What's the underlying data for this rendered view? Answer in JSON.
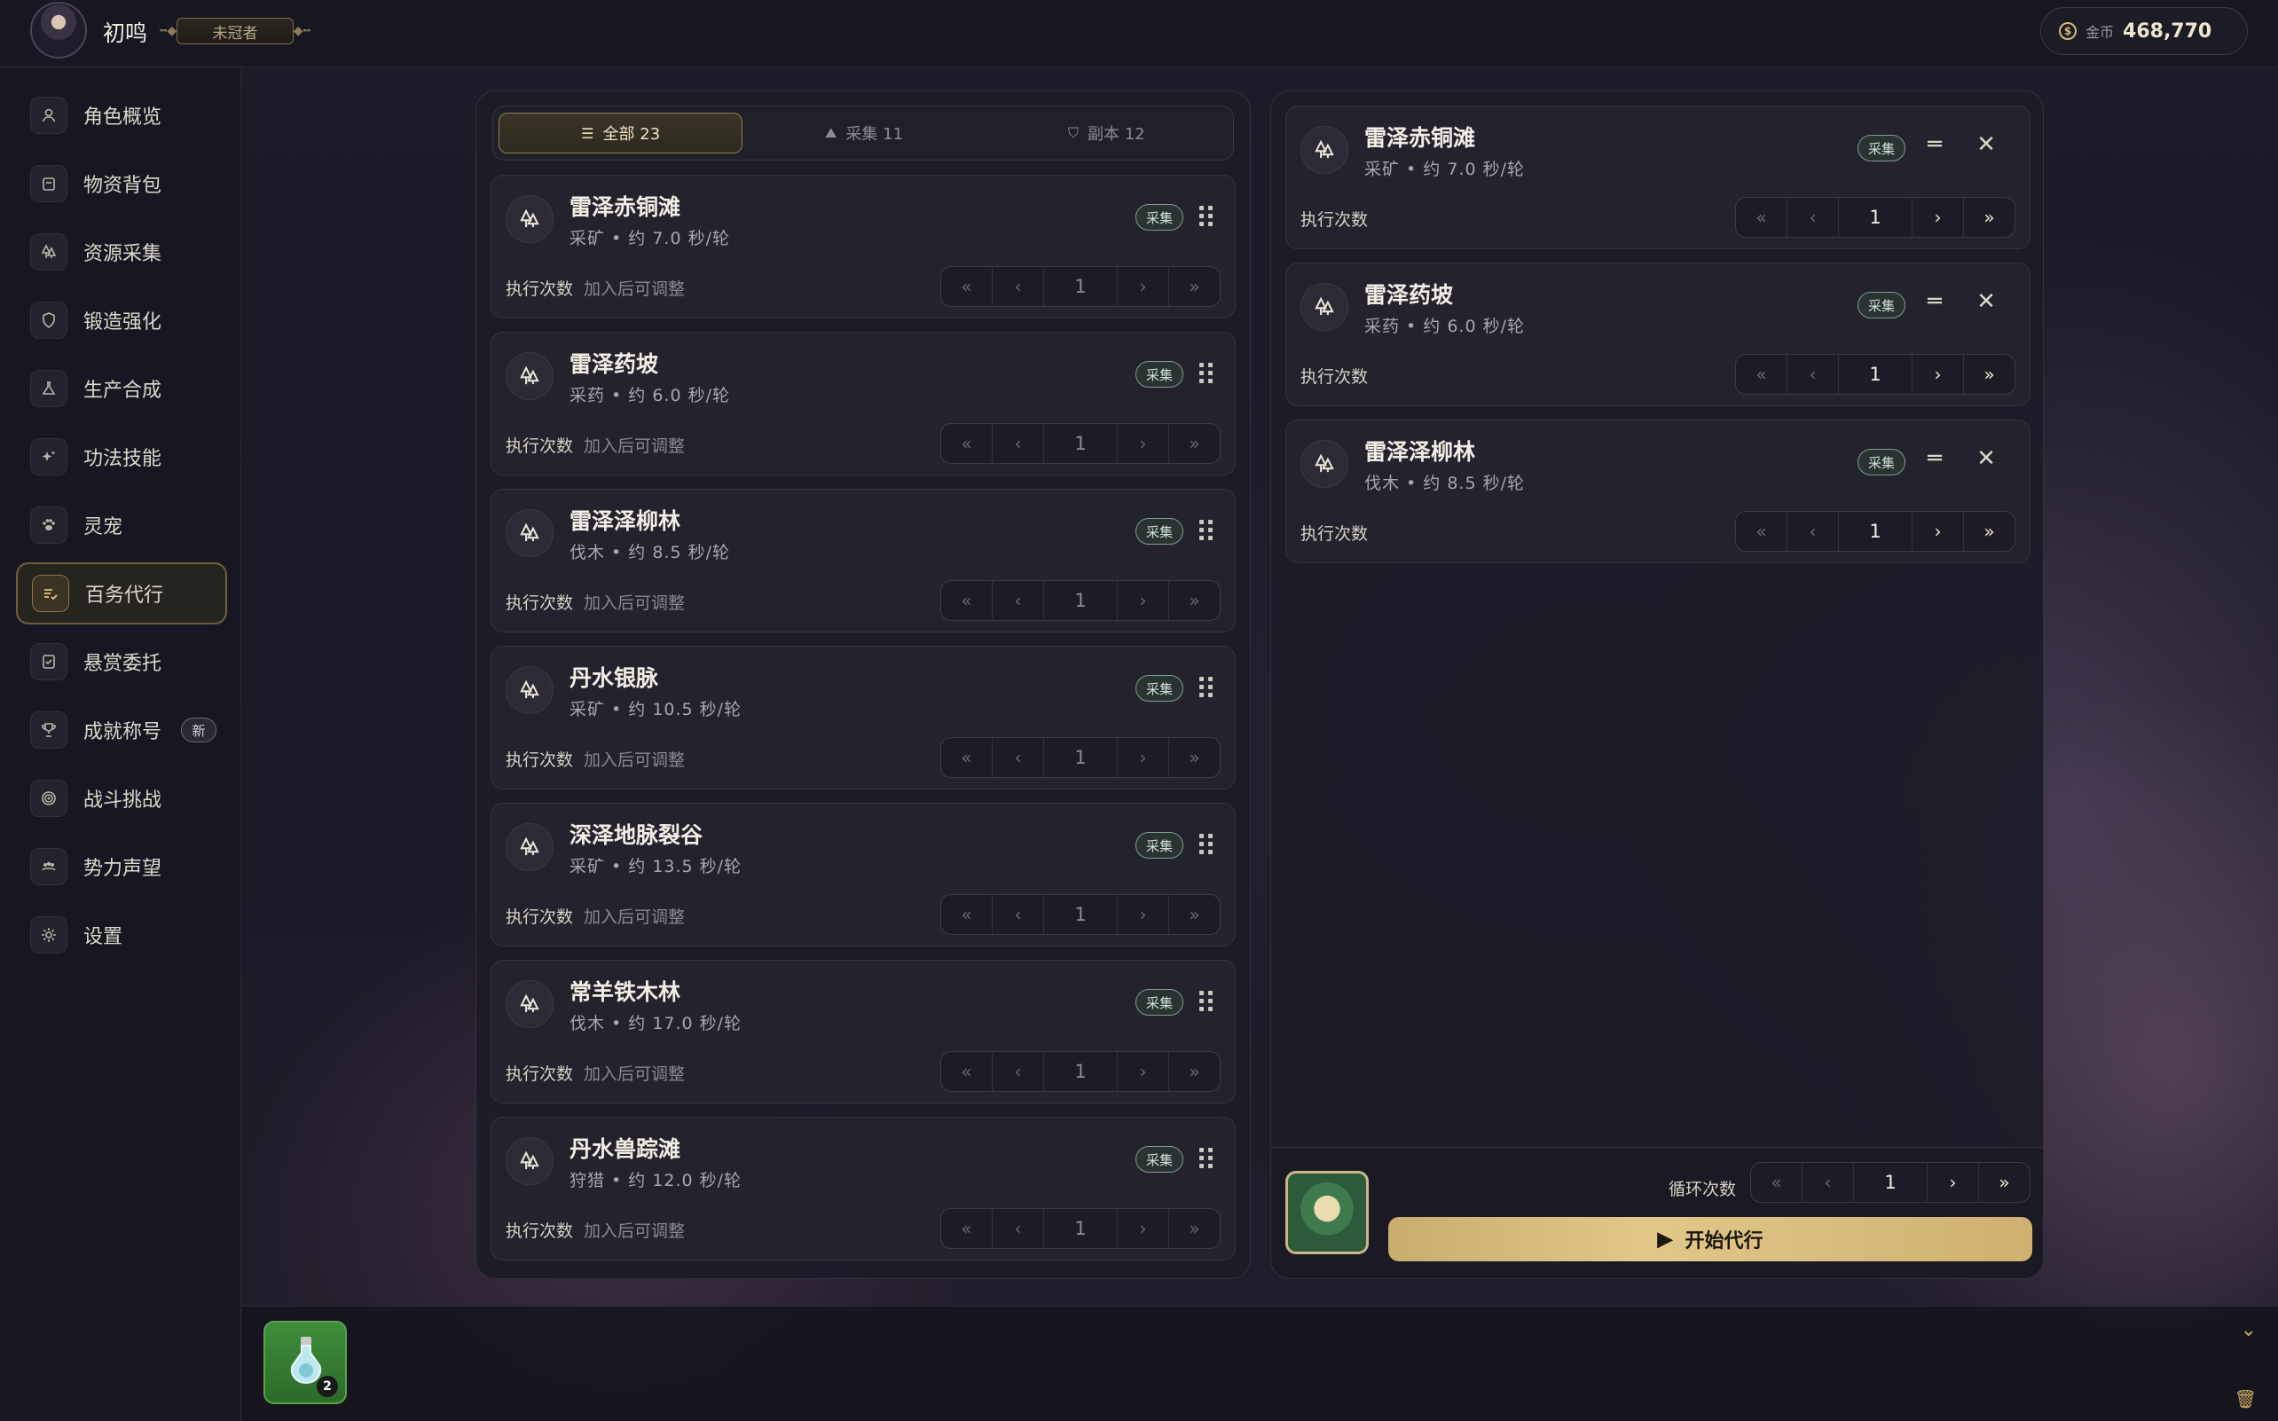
{
  "header": {
    "username": "初鸣",
    "title_badge": "未冠者",
    "gold_label": "金币",
    "gold_value": "468,770"
  },
  "sidebar": {
    "items": [
      {
        "label": "角色概览",
        "icon": "person-icon"
      },
      {
        "label": "物资背包",
        "icon": "backpack-icon"
      },
      {
        "label": "资源采集",
        "icon": "trees-icon"
      },
      {
        "label": "锻造强化",
        "icon": "shield-icon"
      },
      {
        "label": "生产合成",
        "icon": "flask-icon"
      },
      {
        "label": "功法技能",
        "icon": "sparkles-icon"
      },
      {
        "label": "灵宠",
        "icon": "paw-icon"
      },
      {
        "label": "百务代行",
        "icon": "list-check-icon",
        "active": true
      },
      {
        "label": "悬赏委托",
        "icon": "clipboard-check-icon"
      },
      {
        "label": "成就称号",
        "icon": "trophy-icon",
        "badge": "新"
      },
      {
        "label": "战斗挑战",
        "icon": "target-icon"
      },
      {
        "label": "势力声望",
        "icon": "group-icon"
      },
      {
        "label": "设置",
        "icon": "gear-icon"
      }
    ]
  },
  "filters": {
    "all": "全部 23",
    "collect": "采集 11",
    "dungeon": "副本 12"
  },
  "tasks": [
    {
      "name": "雷泽赤铜滩",
      "sub": "采矿 • 约 7.0 秒/轮",
      "tag": "采集",
      "count_label": "执行次数",
      "hint": "加入后可调整",
      "count": "1"
    },
    {
      "name": "雷泽药坡",
      "sub": "采药 • 约 6.0 秒/轮",
      "tag": "采集",
      "count_label": "执行次数",
      "hint": "加入后可调整",
      "count": "1"
    },
    {
      "name": "雷泽泽柳林",
      "sub": "伐木 • 约 8.5 秒/轮",
      "tag": "采集",
      "count_label": "执行次数",
      "hint": "加入后可调整",
      "count": "1"
    },
    {
      "name": "丹水银脉",
      "sub": "采矿 • 约 10.5 秒/轮",
      "tag": "采集",
      "count_label": "执行次数",
      "hint": "加入后可调整",
      "count": "1"
    },
    {
      "name": "深泽地脉裂谷",
      "sub": "采矿 • 约 13.5 秒/轮",
      "tag": "采集",
      "count_label": "执行次数",
      "hint": "加入后可调整",
      "count": "1"
    },
    {
      "name": "常羊铁木林",
      "sub": "伐木 • 约 17.0 秒/轮",
      "tag": "采集",
      "count_label": "执行次数",
      "hint": "加入后可调整",
      "count": "1"
    },
    {
      "name": "丹水兽踪滩",
      "sub": "狩猎 • 约 12.0 秒/轮",
      "tag": "采集",
      "count_label": "执行次数",
      "hint": "加入后可调整",
      "count": "1"
    }
  ],
  "queue": [
    {
      "name": "雷泽赤铜滩",
      "sub": "采矿 • 约 7.0 秒/轮",
      "tag": "采集",
      "count_label": "执行次数",
      "count": "1"
    },
    {
      "name": "雷泽药坡",
      "sub": "采药 • 约 6.0 秒/轮",
      "tag": "采集",
      "count_label": "执行次数",
      "count": "1"
    },
    {
      "name": "雷泽泽柳林",
      "sub": "伐木 • 约 8.5 秒/轮",
      "tag": "采集",
      "count_label": "执行次数",
      "count": "1"
    }
  ],
  "footer": {
    "loop_label": "循环次数",
    "loop_count": "1",
    "start_label": "开始代行"
  },
  "inventory": {
    "potion_count": "2"
  },
  "colors": {
    "accent_gold": "#d4b877",
    "tag_green": "#7f9c92",
    "panel_bg": "#1c1b26"
  }
}
